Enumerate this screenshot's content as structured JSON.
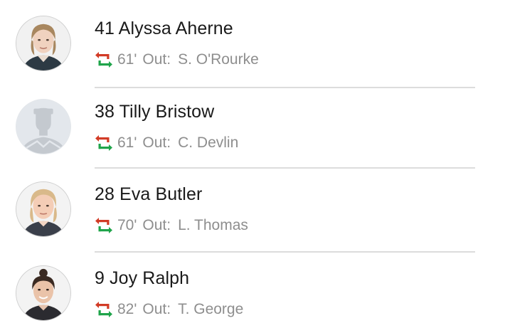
{
  "colors": {
    "sub_out_arrow": "#d23b26",
    "sub_in_arrow": "#1fa44a",
    "secondary_text": "#8e8e8e",
    "divider": "#dcdcdc"
  },
  "players": [
    {
      "number_name": "41 Alyssa Aherne",
      "minute": "61'",
      "out_label": "Out:",
      "replaced": "S. O'Rourke",
      "avatar_icon": "player-photo-icon"
    },
    {
      "number_name": "38 Tilly Bristow",
      "minute": "61'",
      "out_label": "Out:",
      "replaced": "C. Devlin",
      "avatar_icon": "player-placeholder-icon"
    },
    {
      "number_name": "28 Eva Butler",
      "minute": "70'",
      "out_label": "Out:",
      "replaced": "L. Thomas",
      "avatar_icon": "player-photo-icon"
    },
    {
      "number_name": "9 Joy Ralph",
      "minute": "82'",
      "out_label": "Out:",
      "replaced": "T. George",
      "avatar_icon": "player-photo-icon"
    }
  ]
}
